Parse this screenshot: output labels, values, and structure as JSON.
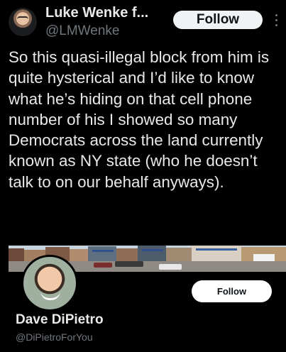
{
  "post": {
    "author_name": "Luke Wenke f...",
    "handle": "@LMWenke",
    "follow_label": "Follow",
    "text": "So this quasi-illegal block from him is quite hysterical and I’d like to know what he’s hiding on that cell phone number of his I showed so many Democrats across the land currently known as NY state (who he doesn’t talk to on our behalf anyways)."
  },
  "profile_card": {
    "name": "Dave DiPietro",
    "handle": "@DiPietroForYou",
    "follow_label": "Follow"
  },
  "icons": {
    "more": "more-vertical-icon"
  },
  "colors": {
    "background": "#000000",
    "text": "#e7e9ea",
    "secondary_text": "#71767b",
    "button": "#eff3f4"
  }
}
